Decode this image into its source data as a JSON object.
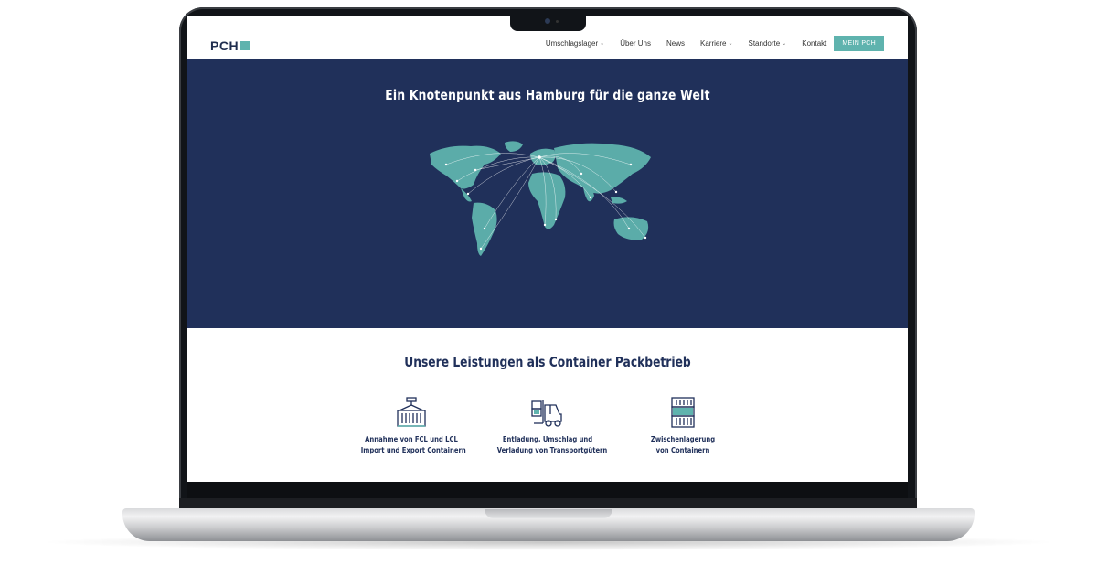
{
  "site": {
    "logo_text": "PCH",
    "brand_color": "#5fb3ae",
    "navy_color": "#20305a"
  },
  "nav": {
    "items": [
      {
        "label": "Umschlagslager",
        "dropdown": true
      },
      {
        "label": "Über Uns",
        "dropdown": false
      },
      {
        "label": "News",
        "dropdown": false
      },
      {
        "label": "Karriere",
        "dropdown": true
      },
      {
        "label": "Standorte",
        "dropdown": true
      },
      {
        "label": "Kontakt",
        "dropdown": false
      }
    ],
    "cta_label": "MEIN PCH",
    "chevron_glyph": "⌄"
  },
  "hero": {
    "title": "Ein Knotenpunkt aus Hamburg für die ganze Welt",
    "map_icon": "world-map-routes"
  },
  "services": {
    "title": "Unsere Leistungen als Container Packbetrieb",
    "items": [
      {
        "icon": "container-crane-icon",
        "line1": "Annahme von FCL und LCL",
        "line2": "Import und Export Containern"
      },
      {
        "icon": "forklift-icon",
        "line1": "Entladung, Umschlag und",
        "line2": "Verladung von Transportgütern"
      },
      {
        "icon": "stacked-containers-icon",
        "line1": "Zwischenlagerung",
        "line2": "von Containern"
      }
    ]
  }
}
